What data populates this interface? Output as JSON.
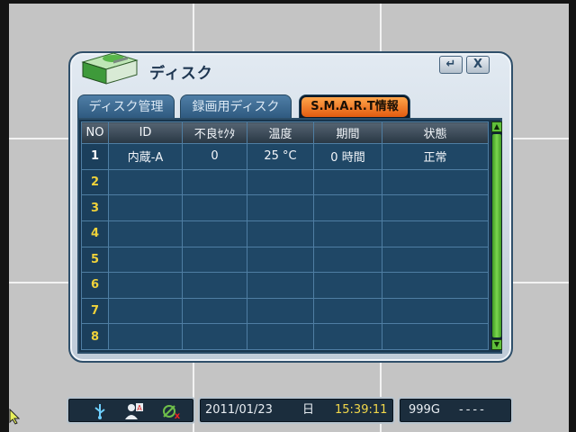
{
  "dialog": {
    "title": "ディスク",
    "enter_label": "↵",
    "close_label": "X"
  },
  "tabs": [
    {
      "label": "ディスク管理",
      "active": false
    },
    {
      "label": "録画用ディスク",
      "active": false
    },
    {
      "label": "S.M.A.R.T情報",
      "active": true
    }
  ],
  "table": {
    "headers": [
      "NO",
      "ID",
      "不良ｾｸﾀ",
      "温度",
      "期間",
      "状態"
    ],
    "rows": [
      [
        "1",
        "内蔵-A",
        "0",
        "25 °C",
        "0 時間",
        "正常"
      ],
      [
        "2",
        "",
        "",
        "",
        "",
        ""
      ],
      [
        "3",
        "",
        "",
        "",
        "",
        ""
      ],
      [
        "4",
        "",
        "",
        "",
        "",
        ""
      ],
      [
        "5",
        "",
        "",
        "",
        "",
        ""
      ],
      [
        "6",
        "",
        "",
        "",
        "",
        ""
      ],
      [
        "7",
        "",
        "",
        "",
        "",
        ""
      ],
      [
        "8",
        "",
        "",
        "",
        "",
        ""
      ]
    ]
  },
  "statusbar": {
    "icons": [
      "usb-icon",
      "user-record-icon",
      "network-disconnected-icon"
    ],
    "date": "2011/01/23",
    "day_of_week": "日",
    "time": "15:39:11",
    "disk_capacity": "999G",
    "record_status": "----"
  },
  "colors": {
    "active_tab": "#f07a22",
    "row_number": "#f0d23a",
    "panel_bg": "#1f4766",
    "scrollbar": "#5fbf3a"
  }
}
